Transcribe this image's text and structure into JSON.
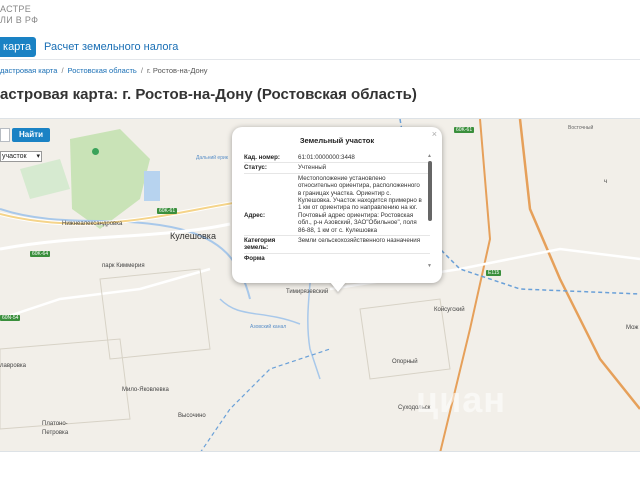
{
  "header": {
    "logo_line1": "АСТРЕ",
    "logo_line2": "ЛИ В РФ"
  },
  "nav": {
    "active_tab": "я карта",
    "link_tab": "Расчет земельного налога"
  },
  "breadcrumb": {
    "items": [
      "дастровая карта",
      "Ростовская область",
      "г. Ростов-на-Дону"
    ],
    "separator": "/"
  },
  "page_title": "астровая карта: г. Ростов-на-Дону (Ростовская область)",
  "map": {
    "find_button": "Найти",
    "layer_select": "участок",
    "watermark": "циан",
    "labels": {
      "kuleshovka": "Кулешовка",
      "kimmeria": "парк Киммерия",
      "nizhnealeks": "Нижнеалександровка",
      "timiryazevsky": "Тимирязевский",
      "koysugsky": "Койсугский",
      "opornyi": "Опорный",
      "sukhodolsk": "Суходольск",
      "milo": "Мило-Яковлевка",
      "vysochino": "Высочино",
      "platono": "Платоно-",
      "petrovka": "Петровка",
      "lavrovka": "лавровка",
      "moy": "Мож",
      "kopor": "ч",
      "r65": "60K-61",
      "r64": "60K-64",
      "r54": "60N-54",
      "e115": "E115",
      "azovsky": "Азовский канал",
      "dalny": "Дальний ерик",
      "r94": "60K-61",
      "vost": "Восточный"
    }
  },
  "popup": {
    "title": "Земельный участок",
    "close": "×",
    "rows": [
      {
        "key": "Кад. номер:",
        "value": "61:01:0000000:3448"
      },
      {
        "key": "Статус:",
        "value": "Учтенный"
      },
      {
        "key": "Адрес:",
        "value": "Местоположение установлено относительно ориентира, расположенного в границах участка. Ориентир с. Кулешовка. Участок находится примерно в 1 км от ориентира по направлению на юг. Почтовый адрес ориентира: Ростовская обл., р-н Азовский, ЗАО\"Обильное\", поля 86-88, 1 км от с. Кулешовка"
      },
      {
        "key": "Категория земель:",
        "value": "Земли сельскохозяйственного назначения"
      },
      {
        "key": "Форма",
        "value": ""
      }
    ]
  },
  "colors": {
    "accent": "#1a82c4",
    "link": "#1a6fb5",
    "map_bg": "#f2efe9"
  }
}
